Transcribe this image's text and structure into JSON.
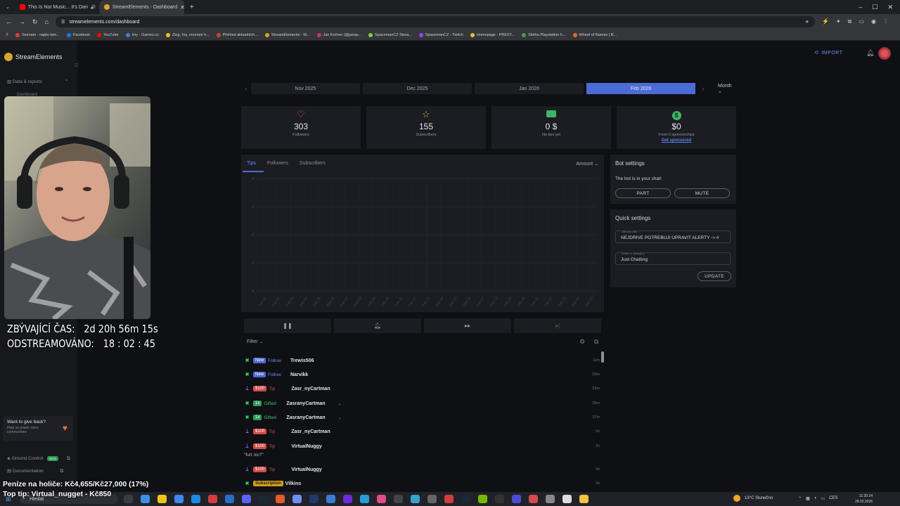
{
  "browser": {
    "tabs": [
      {
        "title": "This Is Not Music... It's Dari",
        "color": "#ff0000"
      },
      {
        "title": "StreamElements - Dashboard",
        "color": "#d7a72a"
      }
    ],
    "url": "streamelements.com/dashboard",
    "bookmarks": [
      "Seznam - najdu tam...",
      "Facebook",
      "YouTube",
      "Hry - Games.cz",
      "Zing, hry, recenze h...",
      "Přehled aktualních...",
      "StreamElements - M...",
      "Jan Kočner (@jansp...",
      "SpacemanCZ Strea...",
      "SpacemanCZ - Twitch",
      "Homepage - PREST...",
      "Sbírka Playstation h...",
      "Wheel of Names | R..."
    ]
  },
  "sidebar": {
    "brand": "StreamElements",
    "section": "Data & reports",
    "item": "Dashboard",
    "give_title": "Want to give back?",
    "give_text": "Help us power more communities",
    "ground_control": "Ground Control",
    "beta": "BETA",
    "documentation": "Documentation"
  },
  "overlay": {
    "remaining_label": "ZBÝVAJÍCÍ ČAS:",
    "remaining_value": "2d 20h 56m 15s",
    "streamed_label": "ODSTREAMOVÁNO:",
    "streamed_value": "18 : 02 : 45",
    "money": "Peníze na holiče: Kč4,655/Kč27,000 (17%)",
    "top_tip": "Top tip: Virtual_nugget - Kč850"
  },
  "header": {
    "import": "IMPORT"
  },
  "months": {
    "items": [
      "Nov 2025",
      "Dec 2025",
      "Jan 2026",
      "Feb 2026"
    ],
    "selected": 3,
    "mode": "Month"
  },
  "stats": [
    {
      "icon": "heart-icon",
      "value": "303",
      "label": "Followers"
    },
    {
      "icon": "star-icon",
      "value": "155",
      "label": "Subscribers"
    },
    {
      "icon": "money-icon",
      "value": "0 $",
      "label": "No tips yet"
    },
    {
      "icon": "dollar-icon",
      "value": "$0",
      "label": "From 0 sponsorships",
      "link": "Get sponsored"
    }
  ],
  "chart_tabs": [
    "Tips",
    "Followers",
    "Subscribers"
  ],
  "chart_metric": "Amount",
  "chart_data": {
    "type": "bar",
    "categories": [
      "Feb 01",
      "Feb 02",
      "Feb 03",
      "Feb 04",
      "Feb 05",
      "Feb 06",
      "Feb 07",
      "Feb 08",
      "Feb 09",
      "Feb 10",
      "Feb 11",
      "Feb 12",
      "Feb 13",
      "Feb 14",
      "Feb 15",
      "Feb 16",
      "Feb 17",
      "Feb 18",
      "Feb 19",
      "Feb 20",
      "Feb 21",
      "Feb 22",
      "Feb 23",
      "Feb 24",
      "Feb 25"
    ],
    "values": [
      0,
      0,
      0,
      0,
      0,
      0,
      0,
      0,
      0,
      0,
      0,
      0,
      0,
      0,
      0,
      0,
      0,
      0,
      0,
      0,
      0,
      0,
      0,
      0,
      0
    ],
    "yticks": [
      0,
      1,
      2,
      3,
      4
    ],
    "ylim": [
      0,
      4
    ],
    "grid": true
  },
  "controls": [
    "pause",
    "bell",
    "skip",
    "end"
  ],
  "filter_label": "Filter",
  "feed": [
    {
      "platform": "twitch",
      "badge": "New",
      "badge_kind": "new",
      "type": "Follow",
      "type_kind": "follow",
      "name": "Trewis506",
      "time": "11m"
    },
    {
      "platform": "twitch",
      "badge": "New",
      "badge_kind": "new",
      "type": "Follow",
      "type_kind": "follow",
      "name": "Narvikk",
      "time": "20m"
    },
    {
      "platform": "se",
      "badge": "$100",
      "badge_kind": "amt",
      "type": "Tip",
      "type_kind": "tip",
      "name": "Zasr_nyCartman",
      "time": "33m"
    },
    {
      "platform": "twitch",
      "badge": "1x",
      "badge_kind": "1x",
      "type": "Gifted",
      "type_kind": "gift",
      "name": "ZasranyCartman",
      "time": "35m",
      "chev": true
    },
    {
      "platform": "twitch",
      "badge": "1x",
      "badge_kind": "1x",
      "type": "Gifted",
      "type_kind": "gift",
      "name": "ZasranyCartman",
      "time": "37m",
      "chev": true
    },
    {
      "platform": "se",
      "badge": "$100",
      "badge_kind": "amt",
      "type": "Tip",
      "type_kind": "tip",
      "name": "Zasr_nyCartman",
      "time": "1h"
    },
    {
      "platform": "se",
      "badge": "$100",
      "badge_kind": "amt",
      "type": "Tip",
      "type_kind": "tip",
      "name": "VirtualNuggy",
      "time": "1h"
    },
    {
      "platform": "se",
      "badge": "$100",
      "badge_kind": "amt",
      "type": "Tip",
      "type_kind": "tip",
      "name": "VirtualNuggy",
      "time": "1h"
    },
    {
      "platform": "twitch",
      "badge": "Subscription",
      "badge_kind": "sub",
      "type": "",
      "type_kind": "",
      "name": "Vilkins",
      "time": "1h"
    }
  ],
  "feed_message": "\"furt nic?\"",
  "bot": {
    "title": "Bot settings",
    "status": "The bot is in your chat!",
    "part": "PART",
    "mute": "MUTE"
  },
  "quick": {
    "title": "Quick settings",
    "title_label": "Stream title",
    "title_value": "NEJDŘÍVE POTŘEBUJI UPRAVIT ALERTY -> #",
    "category_label": "Enter a category",
    "category_value": "Just Chatting",
    "update": "UPDATE"
  },
  "taskbar": {
    "search": "Hledat",
    "weather": "13°C Slunečno",
    "lang": "CES",
    "time": "11:30:14",
    "date": "28.02.2026"
  }
}
